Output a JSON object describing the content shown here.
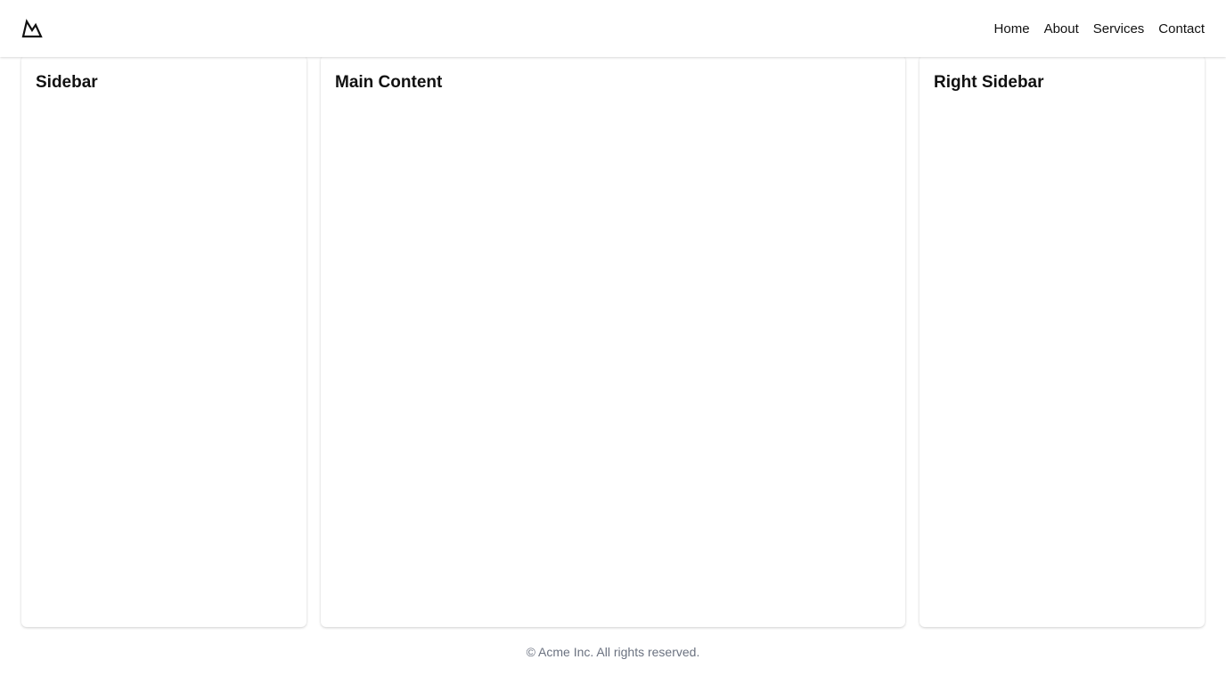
{
  "header": {
    "logo_icon": "mountain-icon",
    "nav": [
      {
        "label": "Home"
      },
      {
        "label": "About"
      },
      {
        "label": "Services"
      },
      {
        "label": "Contact"
      }
    ]
  },
  "sidebar": {
    "title": "Sidebar"
  },
  "main": {
    "title": "Main Content"
  },
  "right_sidebar": {
    "title": "Right Sidebar"
  },
  "footer": {
    "text": "© Acme Inc. All rights reserved."
  },
  "colors": {
    "background": "#ffffff",
    "text": "#111111",
    "footer_text": "#6b7280"
  }
}
